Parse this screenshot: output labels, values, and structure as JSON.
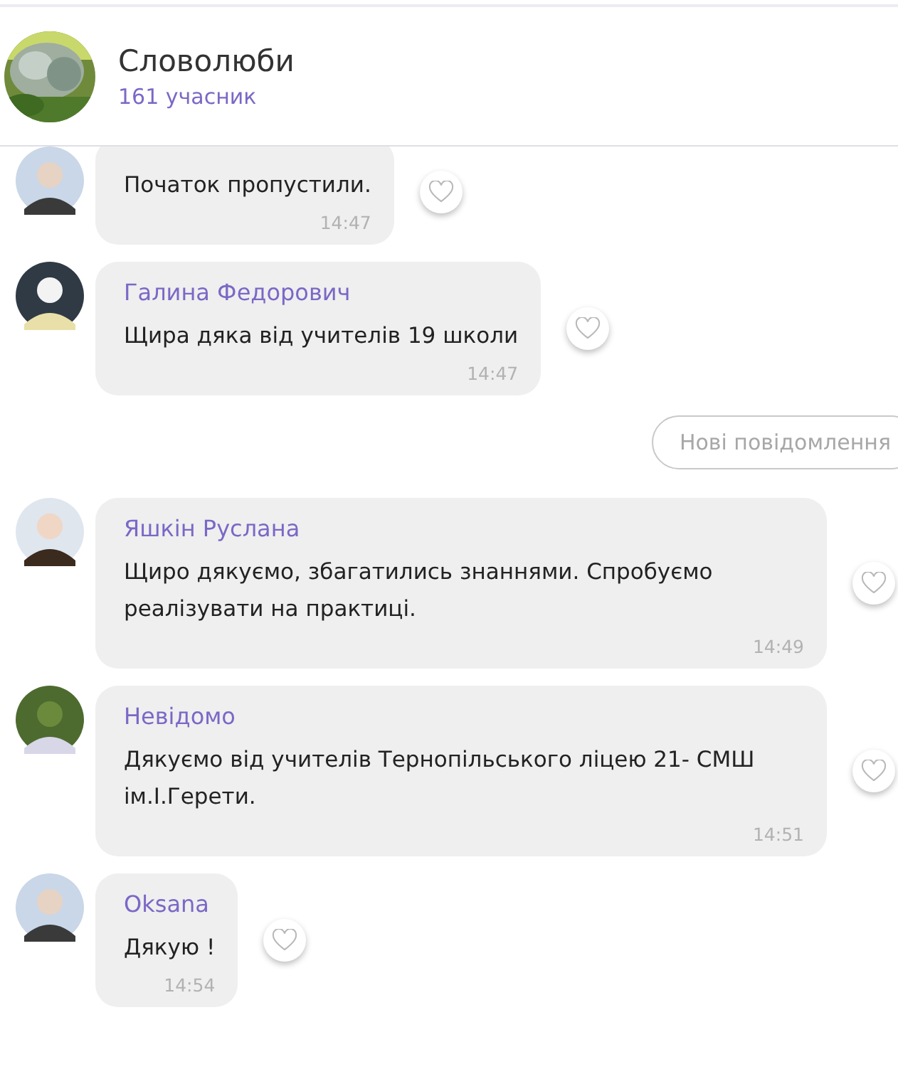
{
  "header": {
    "title": "Словолюби",
    "members": "161 учасник"
  },
  "messages": [
    {
      "text": "Початок пропустили.",
      "time": "14:47"
    },
    {
      "sender": "Галина Федорович",
      "text": "Щира дяка від учителів 19 школи",
      "time": "14:47"
    },
    {
      "kind": "divider",
      "label": "Нові повідомлення"
    },
    {
      "sender": "Яшкін Руслана",
      "text": "Щиро дякуємо, збагатились знаннями. Спробуємо реалізувати на практиці.",
      "time": "14:49"
    },
    {
      "sender": "Невідомо",
      "text": "Дякуємо від учителів Тернопільського ліцею 21- СМШ ім.І.Герети.",
      "time": "14:51"
    },
    {
      "sender": "Oksana",
      "text": "Дякую !",
      "time": "14:54"
    }
  ]
}
